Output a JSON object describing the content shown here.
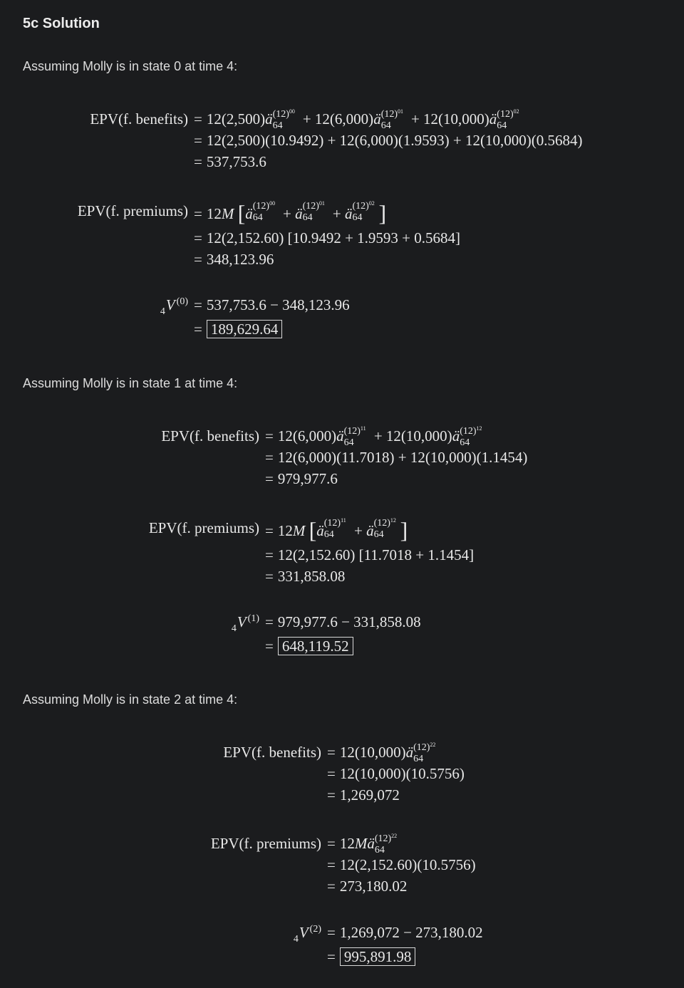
{
  "title": "5c Solution",
  "intro": [
    "Assuming Molly is in state 0 at time 4:",
    "Assuming Molly is in state 1 at time 4:",
    "Assuming Molly is in state 2 at time 4:"
  ],
  "state0": {
    "benefits_lhs": "EPV(f. benefits)",
    "benefits_line2": "12(2,500)(10.9492) + 12(6,000)(1.9593) + 12(10,000)(0.5684)",
    "benefits_line3": "537,753.6",
    "premiums_lhs": "EPV(f. premiums)",
    "premiums_line2": "12(2,152.60) [10.9492 + 1.9593 + 0.5684]",
    "premiums_line3": "348,123.96",
    "v_state": "(0)",
    "v_line1": "537,753.6 − 348,123.96",
    "v_result": "189,629.64"
  },
  "state1": {
    "benefits_lhs": "EPV(f. benefits)",
    "benefits_line2": "12(6,000)(11.7018) + 12(10,000)(1.1454)",
    "benefits_line3": "979,977.6",
    "premiums_lhs": "EPV(f. premiums)",
    "premiums_line2": "12(2,152.60) [11.7018 + 1.1454]",
    "premiums_line3": "331,858.08",
    "v_state": "(1)",
    "v_line1": "979,977.6 − 331,858.08",
    "v_result": "648,119.52"
  },
  "state2": {
    "benefits_lhs": "EPV(f. benefits)",
    "benefits_line2": "12(10,000)(10.5756)",
    "benefits_line3": "1,269,072",
    "premiums_lhs": "EPV(f. premiums)",
    "premiums_line2": "12(2,152.60)(10.5756)",
    "premiums_line3": "273,180.02",
    "v_state": "(2)",
    "v_line1": "1,269,072 − 273,180.02",
    "v_result": "995,891.98"
  }
}
